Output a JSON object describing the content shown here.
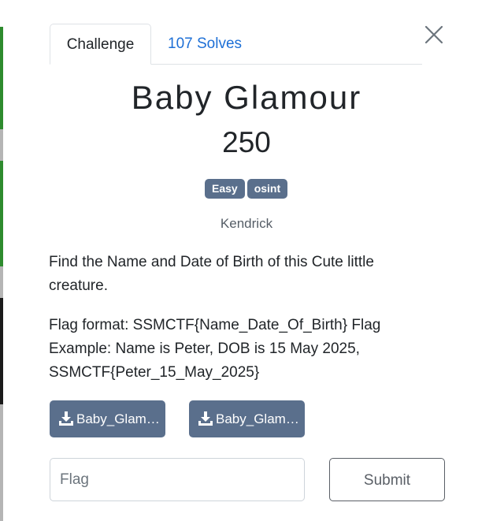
{
  "backdrop": {
    "strip_colors": [
      "#ffffff",
      "#2e8b2e",
      "#b5b5b5",
      "#2e8b2e",
      "#b5b5b5",
      "#1a1a1a",
      "#b5b5b5"
    ]
  },
  "tabs": [
    {
      "label": "Challenge",
      "active": true
    },
    {
      "label": "107 Solves",
      "active": false
    }
  ],
  "challenge": {
    "name": "Baby Glamour",
    "value": "250",
    "tags": [
      "Easy",
      "osint"
    ],
    "author": "Kendrick",
    "description": "Find the Name and Date of Birth of this Cute little creature.",
    "flag_format": "Flag format: SSMCTF{Name_Date_Of_Birth} Flag Example: Name is Peter, DOB is 15 May 2025, SSMCTF{Peter_15_May_2025}",
    "files": [
      {
        "label": "Baby_Glam…"
      },
      {
        "label": "Baby_Glam…"
      }
    ]
  },
  "submission": {
    "placeholder": "Flag",
    "value": "",
    "submit_label": "Submit"
  },
  "colors": {
    "accent_tab": "#1d6fd6",
    "tag_bg": "#5a6f8c",
    "file_btn_bg": "#5a6f8c"
  },
  "icons": {
    "close": "close-icon",
    "download": "download-icon"
  }
}
